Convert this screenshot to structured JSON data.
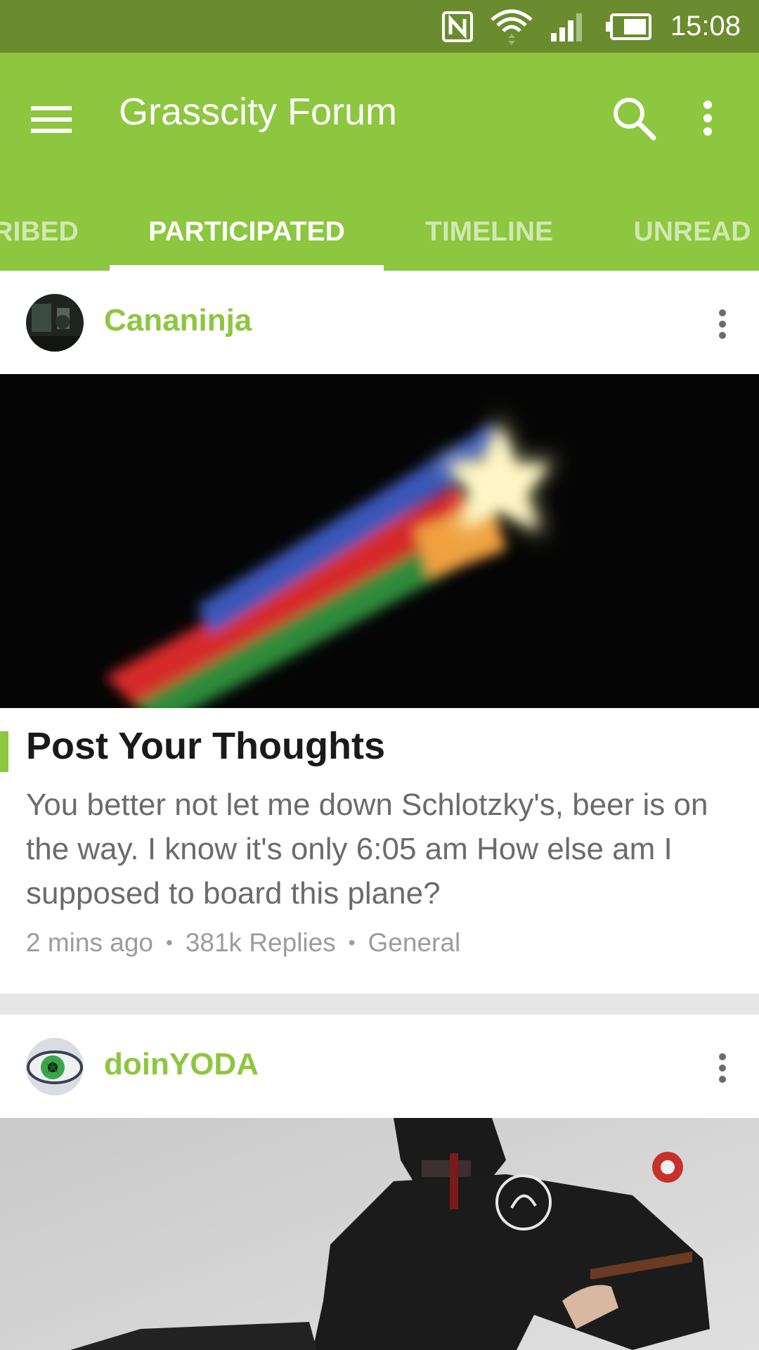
{
  "status_bar": {
    "time": "15:08",
    "icons": [
      "nfc-icon",
      "wifi-icon",
      "signal-icon",
      "battery-icon"
    ]
  },
  "app_bar": {
    "title": "Grasscity Forum",
    "menu_icon": "hamburger-menu-icon",
    "search_icon": "search-icon",
    "overflow_icon": "more-vertical-icon"
  },
  "tabs": [
    {
      "label": "RIBED",
      "active": false
    },
    {
      "label": "PARTICIPATED",
      "active": true
    },
    {
      "label": "TIMELINE",
      "active": false
    },
    {
      "label": "UNREAD",
      "active": false
    }
  ],
  "feed": {
    "posts": [
      {
        "author": "Cananinja",
        "title": "Post Your Thoughts",
        "body": "You better not let me down Schlotzky's, beer is on the way. I know it's only 6:05 am How else am I supposed to board this plane?",
        "time_ago": "2 mins ago",
        "replies": "381k Replies",
        "forum": "General"
      },
      {
        "author": "doinYODA"
      }
    ]
  },
  "colors": {
    "status_bar": "#6a8c2f",
    "primary": "#8dc63f",
    "feed_bg": "#e6e6e6"
  }
}
